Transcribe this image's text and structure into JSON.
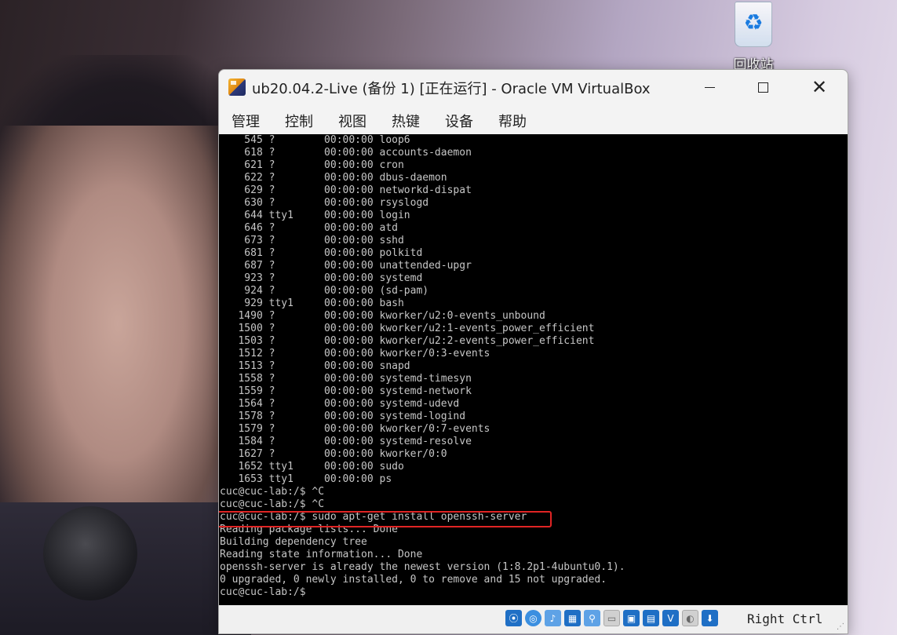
{
  "desktop": {
    "recycle_bin_label": "回收站",
    "recycle_icon": "recycle-bin-icon"
  },
  "window": {
    "title": "ub20.04.2-Live (备份 1) [正在运行] - Oracle VM VirtualBox",
    "controls": {
      "minimize": "minimize-icon",
      "maximize": "maximize-icon",
      "close": "close-icon",
      "close_glyph": "✕"
    },
    "menu": [
      "管理",
      "控制",
      "视图",
      "热键",
      "设备",
      "帮助"
    ]
  },
  "terminal": {
    "lines": [
      "    545 ?        00:00:00 loop6",
      "    618 ?        00:00:00 accounts-daemon",
      "    621 ?        00:00:00 cron",
      "    622 ?        00:00:00 dbus-daemon",
      "    629 ?        00:00:00 networkd-dispat",
      "    630 ?        00:00:00 rsyslogd",
      "    644 tty1     00:00:00 login",
      "    646 ?        00:00:00 atd",
      "    673 ?        00:00:00 sshd",
      "    681 ?        00:00:00 polkitd",
      "    687 ?        00:00:00 unattended-upgr",
      "    923 ?        00:00:00 systemd",
      "    924 ?        00:00:00 (sd-pam)",
      "    929 tty1     00:00:00 bash",
      "   1490 ?        00:00:00 kworker/u2:0-events_unbound",
      "   1500 ?        00:00:00 kworker/u2:1-events_power_efficient",
      "   1503 ?        00:00:00 kworker/u2:2-events_power_efficient",
      "   1512 ?        00:00:00 kworker/0:3-events",
      "   1513 ?        00:00:00 snapd",
      "   1558 ?        00:00:00 systemd-timesyn",
      "   1559 ?        00:00:00 systemd-network",
      "   1564 ?        00:00:00 systemd-udevd",
      "   1578 ?        00:00:00 systemd-logind",
      "   1579 ?        00:00:00 kworker/0:7-events",
      "   1584 ?        00:00:00 systemd-resolve",
      "   1627 ?        00:00:00 kworker/0:0",
      "   1652 tty1     00:00:00 sudo",
      "   1653 tty1     00:00:00 ps",
      "cuc@cuc-lab:/$ ^C",
      "cuc@cuc-lab:/$ ^C",
      "cuc@cuc-lab:/$ sudo apt-get install openssh-server",
      "Reading package lists... Done",
      "Building dependency tree",
      "Reading state information... Done",
      "openssh-server is already the newest version (1:8.2p1-4ubuntu0.1).",
      "0 upgraded, 0 newly installed, 0 to remove and 15 not upgraded.",
      "cuc@cuc-lab:/$"
    ],
    "highlighted_line_index": 30,
    "highlight_color": "#e02424"
  },
  "statusbar": {
    "icons": [
      "hard-disk-icon",
      "optical-drive-icon",
      "audio-icon",
      "network-icon",
      "usb-icon",
      "shared-folders-icon",
      "display-icon",
      "recording-icon",
      "virtualization-icon",
      "mouse-integration-icon",
      "keyboard-capture-icon"
    ],
    "host_key": "Right Ctrl"
  }
}
